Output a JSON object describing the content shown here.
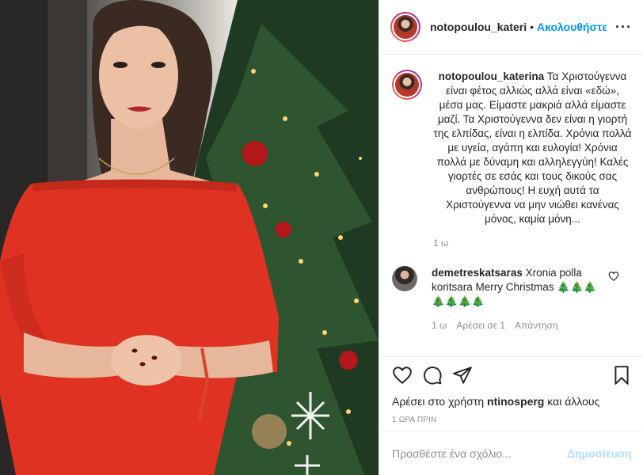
{
  "post": {
    "username": "notopoulou_kateri",
    "dot": "•",
    "follow_label": "Ακολουθήστε",
    "more_label": "···"
  },
  "caption": {
    "username": "notopoulou_katerina",
    "text": "Τα Χριστούγεννα είναι φέτος αλλιώς αλλά είναι «εδώ», μέσα μας. Είμαστε μακριά αλλά είμαστε μαζί. Τα Χριστούγεννα δεν είναι η γιορτή της ελπίδας, είναι η ελπίδα. Χρόνια πολλά με υγεία, αγάπη και ευλογία! Χρόνια πολλά με δύναμη και αλληλεγγύη! Καλές γιορτές σε εσάς και τους δικούς σας ανθρώπους! Η ευχή αυτά τα Χριστούγεννα να μην νιώθει κανένας μόνος, καμία μόνη...",
    "age": "1 ω"
  },
  "comment": {
    "username": "demetreskatsaras",
    "text": "Xronia polla koritsara Merry Christmas 🎄🎄🎄🎄🎄🎄🎄",
    "age": "1 ω",
    "likes": "Αρέσει σε 1",
    "reply": "Απάντηση"
  },
  "actions": {
    "likes_prefix": "Αρέσει στο χρήστη",
    "likes_user": "ntinosperg",
    "likes_suffix": "και άλλους",
    "timestamp": "1 ΩΡΑ ΠΡΙΝ"
  },
  "add_comment": {
    "placeholder": "Προσθέστε ένα σχόλιο...",
    "post_label": "Δημοσίευση"
  },
  "colors": {
    "accent": "#0095f6",
    "post_disabled": "#b2dffc",
    "dress": "#e03222"
  },
  "icons": [
    "heart-icon",
    "comment-icon",
    "share-icon",
    "bookmark-icon",
    "more-icon"
  ]
}
